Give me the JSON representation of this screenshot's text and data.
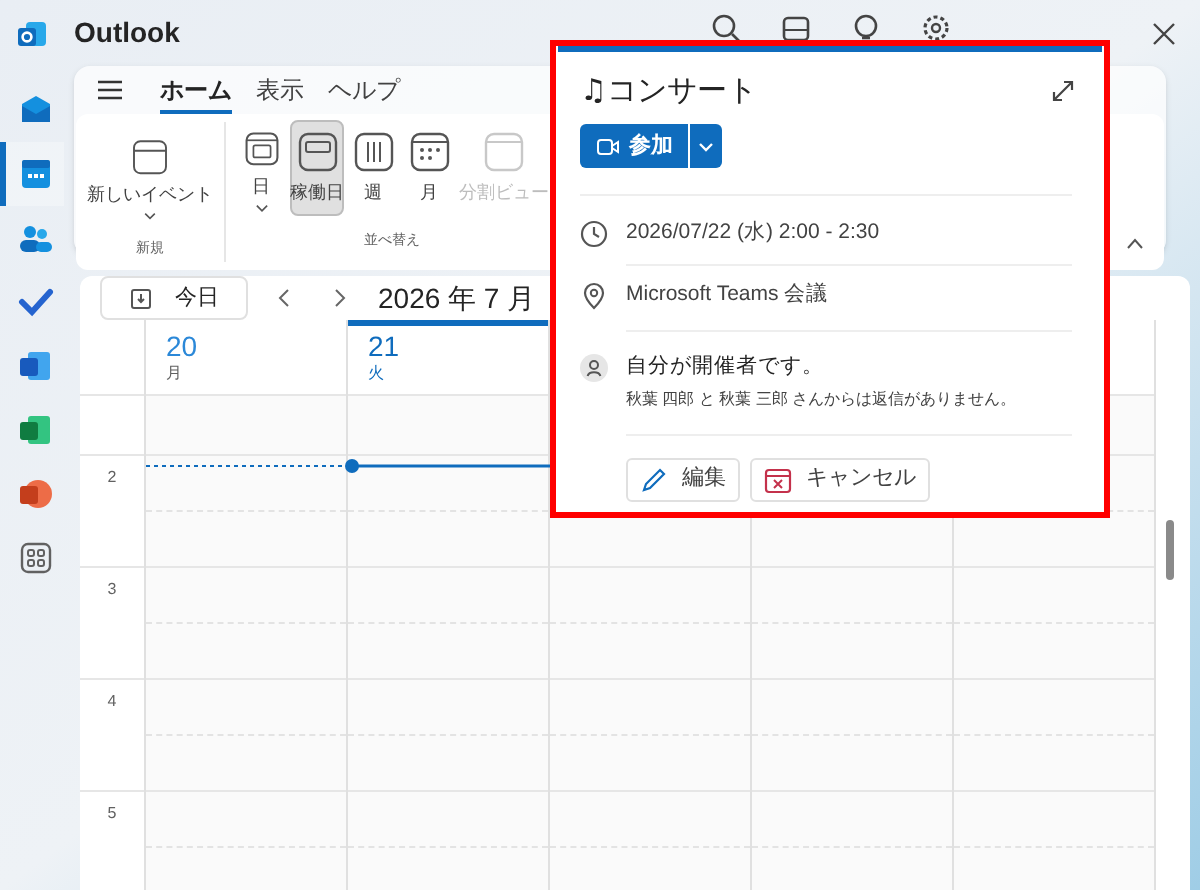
{
  "window": {
    "title": "Outlook"
  },
  "app_rail": [
    {
      "kind": "mail",
      "selected": false
    },
    {
      "kind": "calendar",
      "selected": true
    },
    {
      "kind": "people",
      "selected": false
    },
    {
      "kind": "todo",
      "selected": false
    },
    {
      "kind": "doc",
      "selected": false
    },
    {
      "kind": "sheet",
      "selected": false
    },
    {
      "kind": "slides",
      "selected": false
    },
    {
      "kind": "apps",
      "selected": false
    }
  ],
  "ribbon": {
    "tabs": [
      {
        "label": "ホーム",
        "selected": true
      },
      {
        "label": "表示",
        "selected": false
      },
      {
        "label": "ヘルプ",
        "selected": false
      }
    ],
    "groups": [
      {
        "label": "新規",
        "buttons": [
          {
            "kind": "new",
            "label": "新しいイベント",
            "dropdown": true,
            "selected": false,
            "disabled": false
          }
        ]
      },
      {
        "label": "並べ替え",
        "buttons": [
          {
            "kind": "day",
            "label": "日",
            "dropdown": true,
            "selected": false,
            "disabled": false
          },
          {
            "kind": "workweek",
            "label": "稼働日",
            "dropdown": false,
            "selected": true,
            "disabled": false
          },
          {
            "kind": "week",
            "label": "週",
            "dropdown": false,
            "selected": false,
            "disabled": false
          },
          {
            "kind": "month",
            "label": "月",
            "dropdown": false,
            "selected": false,
            "disabled": false
          },
          {
            "kind": "split",
            "label": "分割ビュー",
            "dropdown": false,
            "selected": false,
            "disabled": true
          }
        ]
      }
    ]
  },
  "calendar": {
    "today_button": "今日",
    "title": "2026 年 7 月",
    "days": [
      {
        "date": "20",
        "weekday": "月",
        "today": false
      },
      {
        "date": "21",
        "weekday": "火",
        "today": true
      }
    ],
    "hours": [
      "2",
      "3",
      "4",
      "5"
    ]
  },
  "event_popup": {
    "title": "♫コンサート",
    "join_button": "参加",
    "datetime": "2026/07/22 (水) 2:00 - 2:30",
    "location": "Microsoft Teams 会議",
    "organizer": "自分が開催者です。",
    "responses": "秋葉 四郎 と 秋葉 三郎 さんからは返信がありません。",
    "actions": [
      {
        "kind": "edit",
        "label": "編集"
      },
      {
        "kind": "cancel",
        "label": "キャンセル"
      }
    ]
  }
}
